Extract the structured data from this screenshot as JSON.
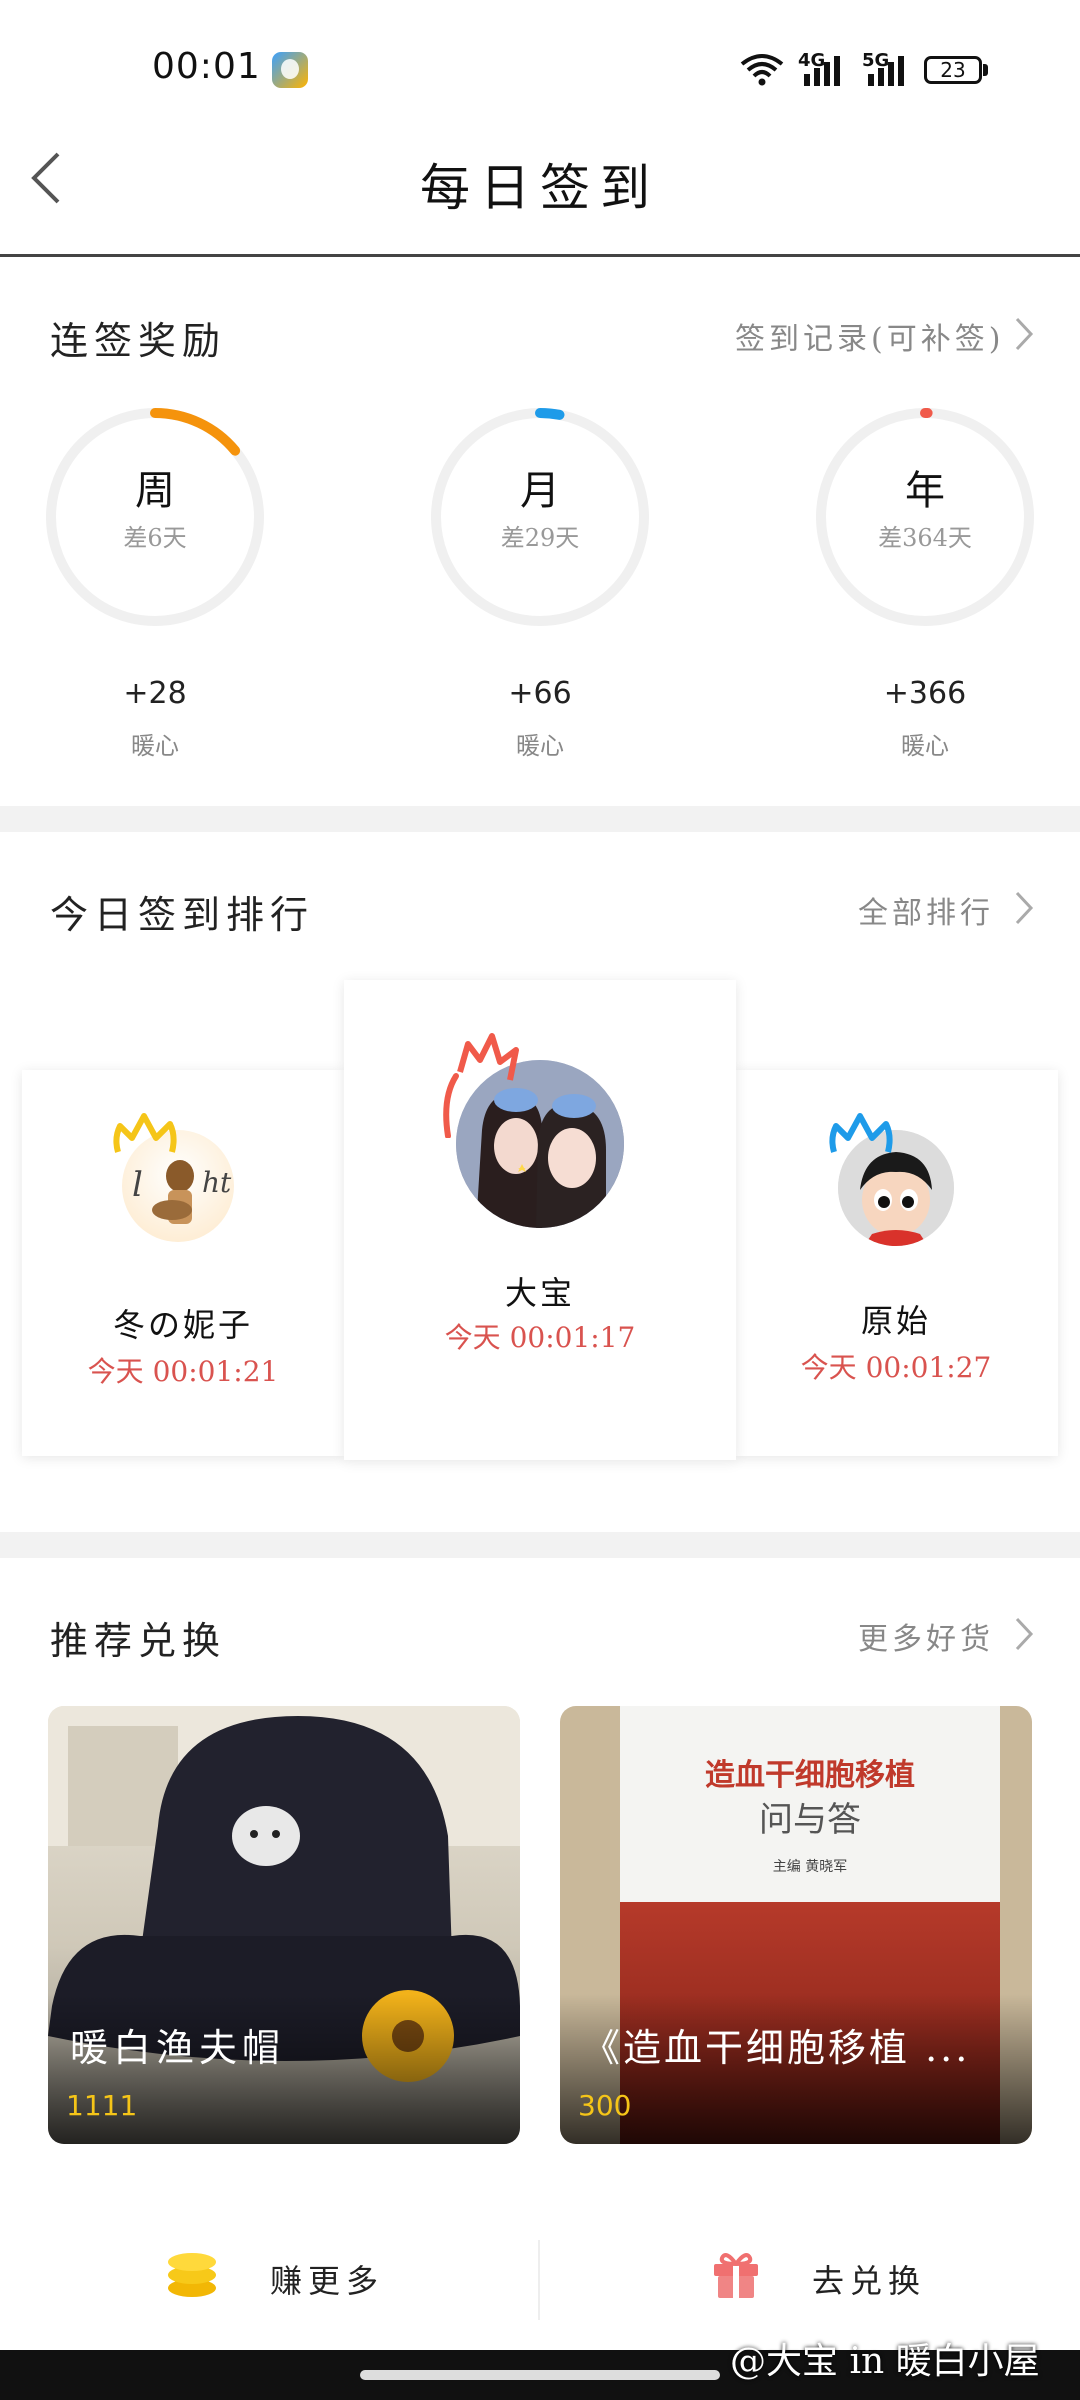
{
  "status_bar": {
    "time": "00:01",
    "battery": "23",
    "network_1": "4G",
    "network_2": "5G"
  },
  "header": {
    "title": "每日签到"
  },
  "streak": {
    "title": "连签奖励",
    "link": "签到记录(可补签)",
    "items": [
      {
        "label": "周",
        "remaining": "差6天",
        "bonus": "+28",
        "unit": "暖心",
        "color": "#f5930c",
        "progress": 0.14
      },
      {
        "label": "月",
        "remaining": "差29天",
        "bonus": "+66",
        "unit": "暖心",
        "color": "#1e9be9",
        "progress": 0.03
      },
      {
        "label": "年",
        "remaining": "差364天",
        "bonus": "+366",
        "unit": "暖心",
        "color": "#f05a4a",
        "progress": 0.003
      }
    ]
  },
  "ranking": {
    "title": "今日签到排行",
    "link": "全部排行",
    "entries": [
      {
        "rank": 2,
        "name": "冬の妮子",
        "time": "今天 00:01:21",
        "crown_color": "#f5c518"
      },
      {
        "rank": 1,
        "name": "大宝",
        "time": "今天 00:01:17",
        "crown_color": "#f05a4a"
      },
      {
        "rank": 3,
        "name": "原始",
        "time": "今天 00:01:27",
        "crown_color": "#1e9be9"
      }
    ]
  },
  "recommend": {
    "title": "推荐兑换",
    "link": "更多好货",
    "products": [
      {
        "name": "暖白渔夫帽",
        "price": "1111"
      },
      {
        "name": "《造血干细胞移植 ...",
        "price": "300",
        "book_title": "造血干细胞移植",
        "book_subtitle": "问与答",
        "book_editor": "主编  黄晓军"
      }
    ]
  },
  "bottom": {
    "earn_label": "赚更多",
    "exchange_label": "去兑换"
  },
  "watermark": "@大宝 in 暖白小屋",
  "colors": {
    "accent_red": "#d9534f",
    "price_yellow": "#f5c518"
  }
}
